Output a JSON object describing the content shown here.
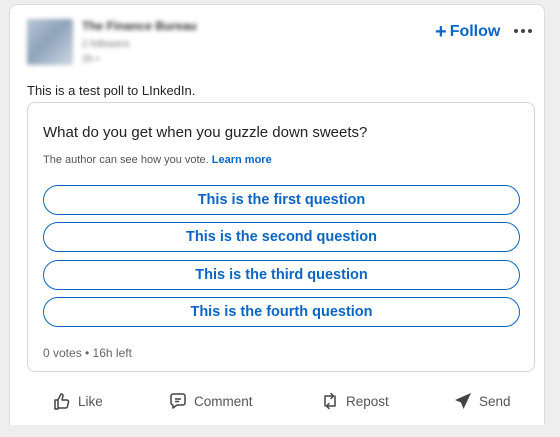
{
  "post": {
    "author": {
      "name": "The Finance Bureau",
      "followers": "2 followers",
      "time": "2h • "
    },
    "follow_label": "Follow",
    "follow_plus": "+",
    "more_icon": "more-horizontal-icon",
    "text": "This is a test poll to LInkedIn."
  },
  "poll": {
    "question": "What do you get when you guzzle down sweets?",
    "note": "The author can see how you vote.",
    "learn_more": "Learn more",
    "options": [
      "This is the first question",
      "This is the second question",
      "This is the third question",
      "This is the fourth question"
    ],
    "status": "0 votes • 16h left"
  },
  "actions": {
    "like": "Like",
    "comment": "Comment",
    "repost": "Repost",
    "send": "Send"
  },
  "colors": {
    "accent": "#0a66c2",
    "background": "#eeeeee",
    "card": "#ffffff"
  }
}
